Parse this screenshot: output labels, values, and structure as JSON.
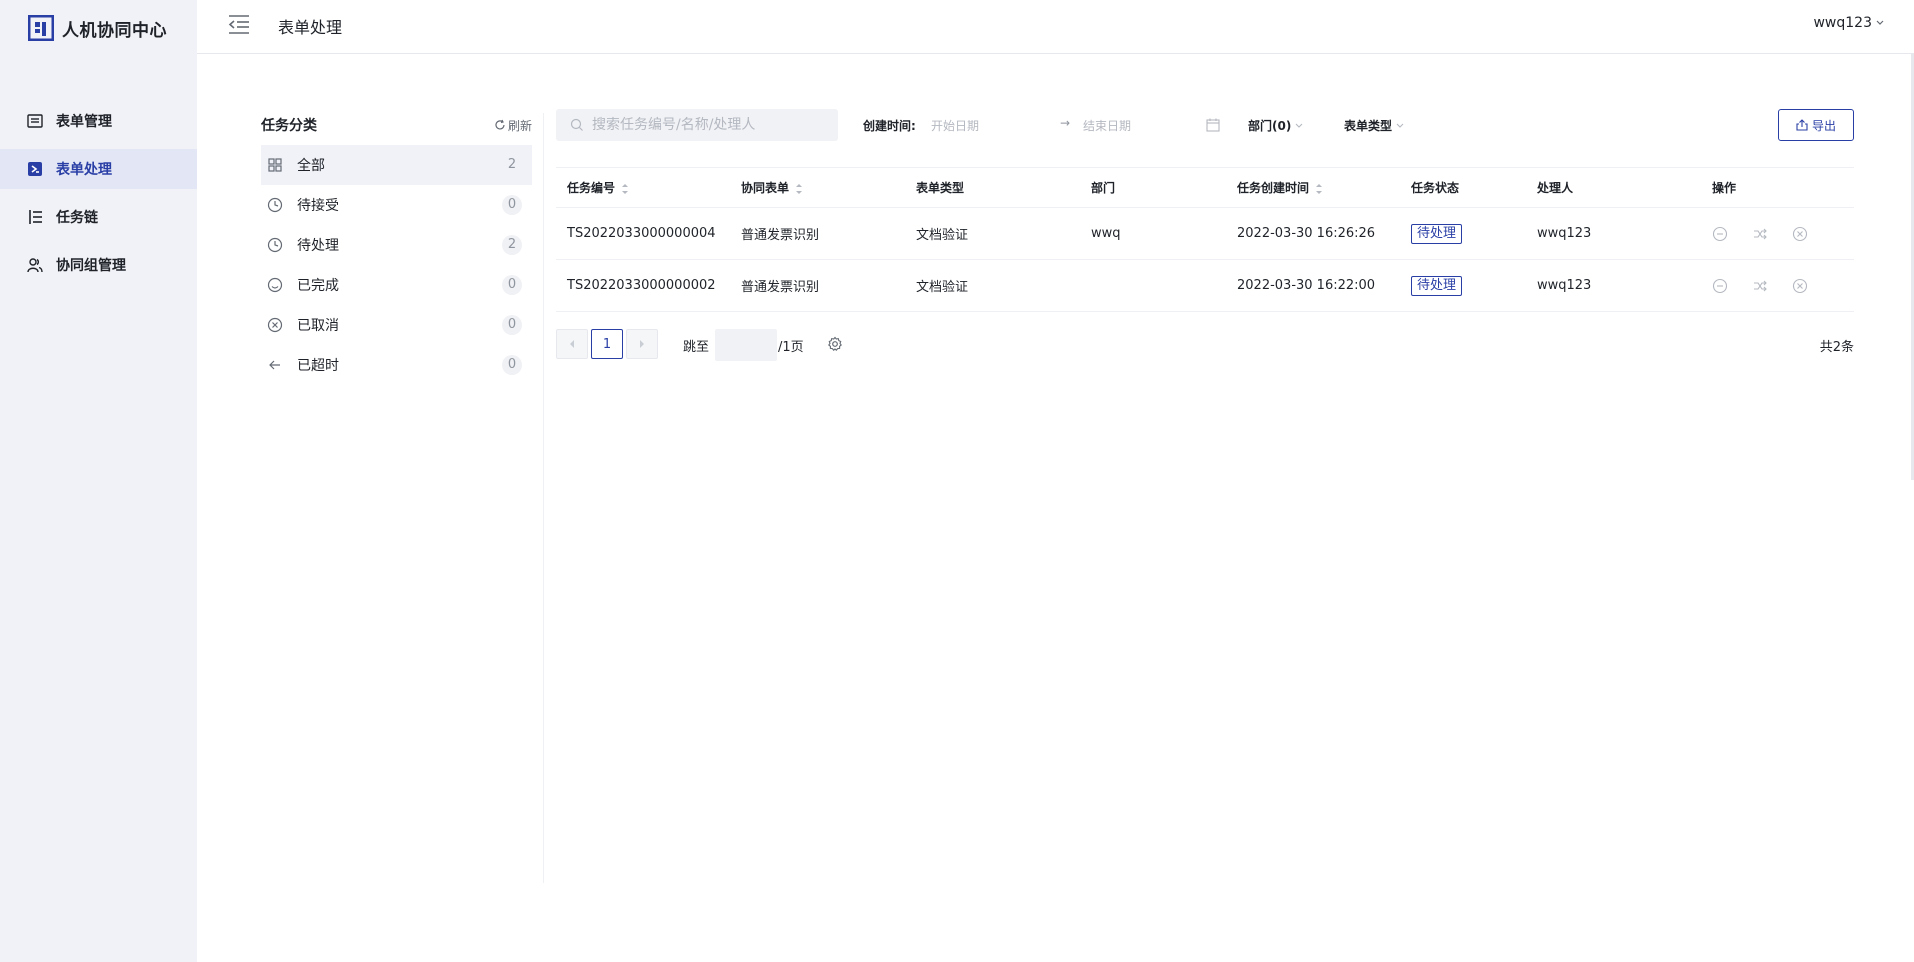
{
  "brand": {
    "name": "人机协同中心"
  },
  "sidebar": {
    "items": [
      {
        "label": "表单管理",
        "icon": "form-list-icon",
        "active": false
      },
      {
        "label": "表单处理",
        "icon": "form-process-icon",
        "active": true
      },
      {
        "label": "任务链",
        "icon": "task-chain-icon",
        "active": false
      },
      {
        "label": "协同组管理",
        "icon": "group-icon",
        "active": false
      }
    ]
  },
  "header": {
    "title": "表单处理",
    "user": "wwq123"
  },
  "categories": {
    "title": "任务分类",
    "refresh_label": "刷新",
    "items": [
      {
        "label": "全部",
        "count": "2",
        "icon": "grid-icon"
      },
      {
        "label": "待接受",
        "count": "0",
        "icon": "clock-icon"
      },
      {
        "label": "待处理",
        "count": "2",
        "icon": "clock-icon"
      },
      {
        "label": "已完成",
        "count": "0",
        "icon": "smile-icon"
      },
      {
        "label": "已取消",
        "count": "0",
        "icon": "cancel-circle-icon"
      },
      {
        "label": "已超时",
        "count": "0",
        "icon": "arrow-left-icon"
      }
    ]
  },
  "filters": {
    "search_placeholder": "搜索任务编号/名称/处理人",
    "date_label": "创建时间:",
    "start_placeholder": "开始日期",
    "end_placeholder": "结束日期",
    "dept_label": "部门(0)",
    "type_label": "表单类型",
    "export_label": "导出"
  },
  "table": {
    "columns": {
      "task_id": "任务编号",
      "form": "协同表单",
      "form_type": "表单类型",
      "dept": "部门",
      "created": "任务创建时间",
      "status": "任务状态",
      "handler": "处理人",
      "ops": "操作"
    },
    "rows": [
      {
        "task_id": "TS2022033000000004",
        "form": "普通发票识别",
        "form_type": "文档验证",
        "dept": "wwq",
        "created": "2022-03-30 16:26:26",
        "status": "待处理",
        "handler": "wwq123"
      },
      {
        "task_id": "TS2022033000000002",
        "form": "普通发票识别",
        "form_type": "文档验证",
        "dept": "",
        "created": "2022-03-30 16:22:00",
        "status": "待处理",
        "handler": "wwq123"
      }
    ]
  },
  "pagination": {
    "current": "1",
    "jump_label": "跳至",
    "page_total": "/1页",
    "total": "共2条"
  },
  "colors": {
    "accent": "#2a3fa6",
    "sidebar_bg": "#f1f2f7",
    "active_bg": "#e3e7f5"
  }
}
